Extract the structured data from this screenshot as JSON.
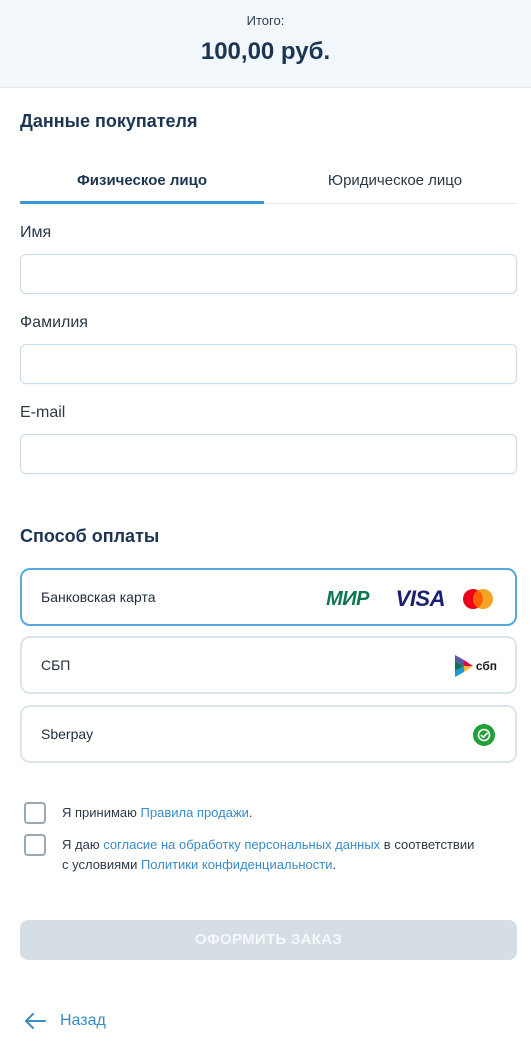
{
  "summary": {
    "label": "Итого:",
    "amount": "100,00 руб."
  },
  "buyer": {
    "title": "Данные покупателя",
    "tabs": [
      {
        "label": "Физическое лицо",
        "active": true
      },
      {
        "label": "Юридическое лицо",
        "active": false
      }
    ],
    "fields": [
      {
        "label": "Имя",
        "value": "",
        "placeholder": ""
      },
      {
        "label": "Фамилия",
        "value": "",
        "placeholder": ""
      },
      {
        "label": "E-mail",
        "value": "",
        "placeholder": ""
      }
    ]
  },
  "payment": {
    "title": "Способ оплаты",
    "options": [
      {
        "label": "Банковская карта",
        "selected": true,
        "logos": [
          "МИР",
          "VISA",
          "mastercard-icon"
        ]
      },
      {
        "label": "СБП",
        "selected": false,
        "logo_text": "сбп"
      },
      {
        "label": "Sberpay",
        "selected": false,
        "logo": "sberpay-icon"
      }
    ]
  },
  "consents": {
    "rules": {
      "prefix": "Я принимаю ",
      "link": "Правила продажи",
      "suffix": "."
    },
    "personal": {
      "prefix": "Я даю ",
      "link1": "согласие на обработку персональных данных",
      "middle": " в соответствии с условиями ",
      "link2": "Политики конфиденциальности",
      "suffix": "."
    }
  },
  "submit_label": "ОФОРМИТЬ ЗАКАЗ",
  "back_label": "Назад",
  "colors": {
    "accent": "#3a96d4",
    "link": "#3a8cc6",
    "title": "#1b3552",
    "disabled_button": "#d6dee5"
  }
}
